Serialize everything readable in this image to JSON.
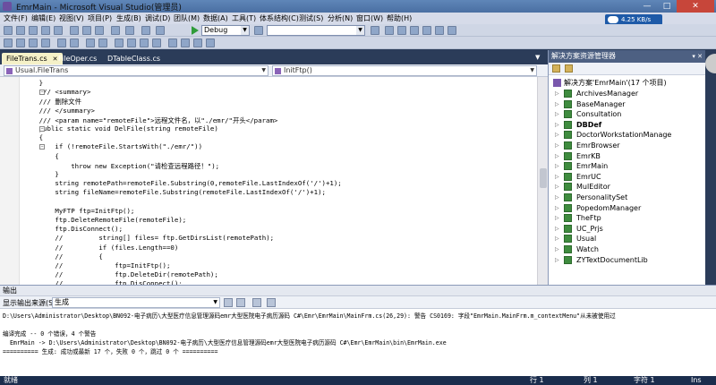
{
  "window": {
    "title": "EmrMain - Microsoft Visual Studio(管理员)",
    "minimize_glyph": "—",
    "maximize_glyph": "□",
    "close_glyph": "✕"
  },
  "menu": [
    "文件(F)",
    "编辑(E)",
    "视图(V)",
    "项目(P)",
    "生成(B)",
    "调试(D)",
    "团队(M)",
    "数据(A)",
    "工具(T)",
    "体系结构(C)",
    "测试(S)",
    "分析(N)",
    "窗口(W)",
    "帮助(H)"
  ],
  "network_speed": "4.25 KB/s",
  "toolbar": {
    "config": "Debug",
    "platform": ""
  },
  "tabs": [
    "FileTrans.cs",
    "FileOper.cs",
    "DTableClass.cs"
  ],
  "tab_close": "✕",
  "navbar": {
    "type": "Usual.FileTrans",
    "member": "InitFtp()"
  },
  "code_lines": [
    "        }",
    "        /// <summary>",
    "        /// 删除文件",
    "        /// </summary>",
    "        /// <param name=\"remoteFile\">远程文件名，以\"./emr/\"开头</param>",
    "        public static void DelFile(string remoteFile)",
    "        {",
    "            if (!remoteFile.StartsWith(\"./emr/\"))",
    "            {",
    "                throw new Exception(\"请检查远程路径！\");",
    "            }",
    "            string remotePath=remoteFile.Substring(0,remoteFile.LastIndexOf('/')+1);",
    "            string fileName=remoteFile.Substring(remoteFile.LastIndexOf('/')+1);",
    "",
    "            MyFTP ftp=InitFtp();",
    "            ftp.DeleteRemoteFile(remoteFile);",
    "            ftp.DisConnect();",
    "            //         string[] files= ftp.GetDirsList(remotePath);",
    "            //         if (files.Length==0)",
    "            //         {",
    "            //             ftp=InitFtp();",
    "            //             ftp.DeleteDir(remotePath);",
    "            //             ftp.DisConnect();",
    "            //         }"
  ],
  "solution_explorer": {
    "title": "解决方案资源管理器",
    "root": "解决方案'EmrMain'(17 个项目)",
    "projects": [
      "ArchivesManager",
      "BaseManager",
      "Consultation",
      "DBDef",
      "DoctorWorkstationManage",
      "EmrBrowser",
      "EmrKB",
      "EmrMain",
      "EmrUC",
      "MulEditor",
      "PersonalitySet",
      "PopedomManager",
      "TheFtp",
      "UC_Prjs",
      "Usual",
      "Watch",
      "ZYTextDocumentLib"
    ],
    "bold_project": "DBDef"
  },
  "output": {
    "title": "输出",
    "source_label": "显示输出来源(S):",
    "source_value": "生成",
    "lines": [
      "D:\\Users\\Administrator\\Desktop\\BN092-电子病历\\大型医疗信息管理源码emr大型医院电子病历源码 C#\\Emr\\EmrMain\\MainFrm.cs(26,29): 警告 CS0169: 字段\"EmrMain.MainFrm.m_contextMenu\"从未被使用过",
      "",
      "编译完成 -- 0 个错误，4 个警告",
      "  EmrMain -> D:\\Users\\Administrator\\Desktop\\BN092-电子病历\\大型医疗信息管理源码emr大型医院电子病历源码 C#\\Emr\\EmrMain\\bin\\EmrMain.exe",
      "========== 生成: 成功或最新 17 个，失败 0 个，跳过 0 个 =========="
    ]
  },
  "status": {
    "left": "就绪",
    "row": "行 1",
    "col": "列 1",
    "char": "字符 1",
    "mode": "Ins"
  },
  "colors": {
    "chrome": "#2b3c59",
    "active_tab": "#f5f1c8",
    "comment": "#008000",
    "keyword": "#0000ff",
    "type": "#2b91af",
    "string": "#a31515"
  }
}
